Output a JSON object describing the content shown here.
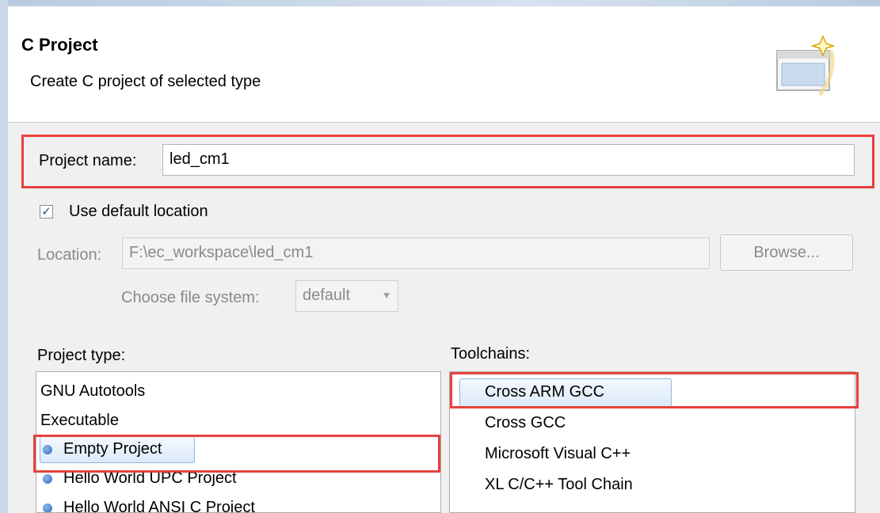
{
  "header": {
    "title": "C Project",
    "subtitle": "Create C project of selected type",
    "icon": "new-project-wizard-icon"
  },
  "project": {
    "name_label": "Project name:",
    "name_value": "led_cm1"
  },
  "location": {
    "use_default_label": "Use default location",
    "use_default_checked": true,
    "location_label": "Location:",
    "location_value": "F:\\ec_workspace\\led_cm1",
    "browse_label": "Browse...",
    "file_system_label": "Choose file system:",
    "file_system_value": "default"
  },
  "project_type": {
    "label": "Project type:",
    "items": [
      {
        "label": "GNU Autotools",
        "bullet": false,
        "selected": false
      },
      {
        "label": "Executable",
        "bullet": false,
        "selected": false
      },
      {
        "label": "Empty Project",
        "bullet": true,
        "selected": true
      },
      {
        "label": "Hello World UPC Project",
        "bullet": true,
        "selected": false
      },
      {
        "label": "Hello World ANSI C Project",
        "bullet": true,
        "selected": false
      }
    ]
  },
  "toolchains": {
    "label": "Toolchains:",
    "items": [
      {
        "label": "Cross ARM GCC",
        "selected": true
      },
      {
        "label": "Cross GCC",
        "selected": false
      },
      {
        "label": "Microsoft Visual C++",
        "selected": false
      },
      {
        "label": "XL C/C++ Tool Chain",
        "selected": false
      }
    ]
  },
  "colors": {
    "highlight_border": "#e8413d",
    "selection_fill": "#dceafb",
    "bullet": "#2f6cc0"
  }
}
